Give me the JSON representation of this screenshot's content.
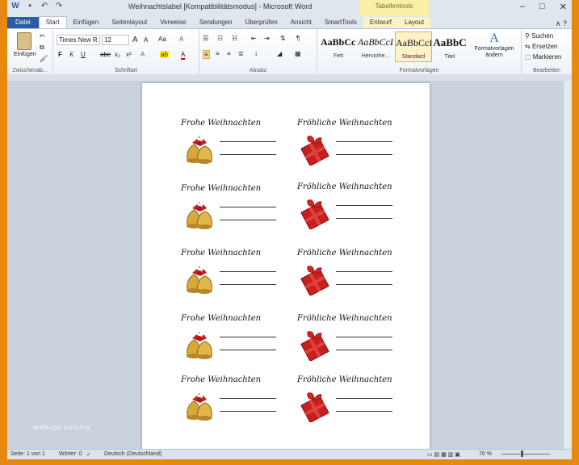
{
  "title_bar": {
    "document_title": "Weihnachtslabel [Kompatibilitätsmodus] - Microsoft Word",
    "contextual_group": "Tabellentools",
    "qat_icons": [
      "word-icon",
      "save-icon",
      "undo-icon",
      "redo-icon"
    ],
    "window_controls": [
      "–",
      "□",
      "✕"
    ]
  },
  "tabs": [
    {
      "label": "Datei",
      "kind": "file"
    },
    {
      "label": "Start",
      "kind": "active"
    },
    {
      "label": "Einfügen",
      "kind": ""
    },
    {
      "label": "Seitenlayout",
      "kind": ""
    },
    {
      "label": "Verweise",
      "kind": ""
    },
    {
      "label": "Sendungen",
      "kind": ""
    },
    {
      "label": "Überprüfen",
      "kind": ""
    },
    {
      "label": "Ansicht",
      "kind": ""
    },
    {
      "label": "SmartTools",
      "kind": ""
    },
    {
      "label": "Entwurf",
      "kind": "ctx"
    },
    {
      "label": "Layout",
      "kind": "ctx"
    }
  ],
  "tabbar_right": "∧ ?",
  "ribbon": {
    "clipboard": {
      "paste_label": "Einfügen",
      "group_label": "Zwischenab..."
    },
    "font": {
      "font_name": "Times New R",
      "font_size": "12",
      "grow": "A",
      "shrink": "A",
      "case": "Aa",
      "clear": "A",
      "bold": "F",
      "italic": "K",
      "underline": "U",
      "strike": "abc",
      "sub": "x₂",
      "sup": "x²",
      "effects": "A",
      "highlight": "ab",
      "color": "A",
      "group_label": "Schriftart"
    },
    "paragraph": {
      "group_label": "Absatz"
    },
    "styles": {
      "items": [
        {
          "sample": "AaBbCcI",
          "name": "Fett",
          "selected": false
        },
        {
          "sample": "AaBbCcL",
          "name": "Hervorhe...",
          "selected": false
        },
        {
          "sample": "AaBbCcI",
          "name": "Standard",
          "selected": true
        },
        {
          "sample": "AaBbC",
          "name": "Titel",
          "selected": false
        }
      ],
      "change_label": "Formatvorlagen ändern",
      "group_label": "Formatvorlagen"
    },
    "editing": {
      "find": "Suchen",
      "replace": "Ersetzen",
      "select": "Markieren",
      "group_label": "Bearbeiten"
    }
  },
  "labels": [
    {
      "text": "Frohe Weihnachten",
      "image": "bells-icon"
    },
    {
      "text": "Fröhliche Weihnachten",
      "image": "gift-icon"
    },
    {
      "text": "Frohe Weihnachten",
      "image": "bells-icon"
    },
    {
      "text": "Fröhliche Weihnachten",
      "image": "gift-icon"
    },
    {
      "text": "Frohe Weihnachten",
      "image": "bells-icon"
    },
    {
      "text": "Fröhliche Weihnachten",
      "image": "gift-icon"
    },
    {
      "text": "Frohe Weihnachten",
      "image": "bells-icon"
    },
    {
      "text": "Fröhliche Weihnachten",
      "image": "gift-icon"
    },
    {
      "text": "Frohe Weihnachten",
      "image": "bells-icon"
    },
    {
      "text": "Fröhliche Weihnachten",
      "image": "gift-icon"
    }
  ],
  "status_bar": {
    "page": "Seite: 1 von 1",
    "words": "Wörter: 0",
    "language": "Deutsch (Deutschland)",
    "zoom": "70 %"
  },
  "watermark": {
    "bold": "web",
    "rest": "age katalog"
  },
  "colors": {
    "file_tab": "#2a5da8",
    "frame": "#e8890f",
    "workspace": "#c9d2dd",
    "gift_red": "#c8201c",
    "bell_gold": "#d8a93a"
  }
}
